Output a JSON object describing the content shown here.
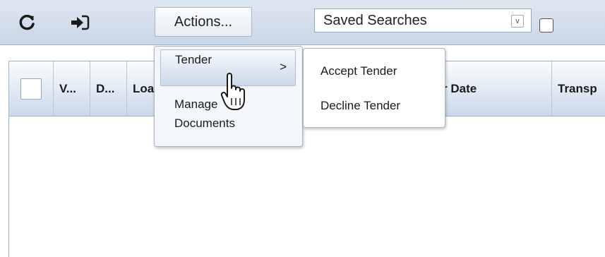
{
  "toolbar": {
    "refresh_icon": "refresh-icon",
    "export_icon": "sign-in-icon",
    "actions_label": "Actions...",
    "saved_searches_value": "Saved Searches",
    "saved_searches_chevron": "v"
  },
  "grid": {
    "columns": [
      "V...",
      "D...",
      "Loa",
      "r Date",
      "Transp"
    ]
  },
  "actions_menu": {
    "items": [
      {
        "label": "Tender",
        "arrow": ">"
      },
      {
        "label": "Manage Documents"
      }
    ]
  },
  "tender_submenu": {
    "items": [
      "Accept Tender",
      "Decline Tender"
    ]
  },
  "colors": {
    "toolbar_bg": "#c9d6e6",
    "header_bg": "#c9d9ea",
    "menu_bg": "#f4f7fa"
  }
}
